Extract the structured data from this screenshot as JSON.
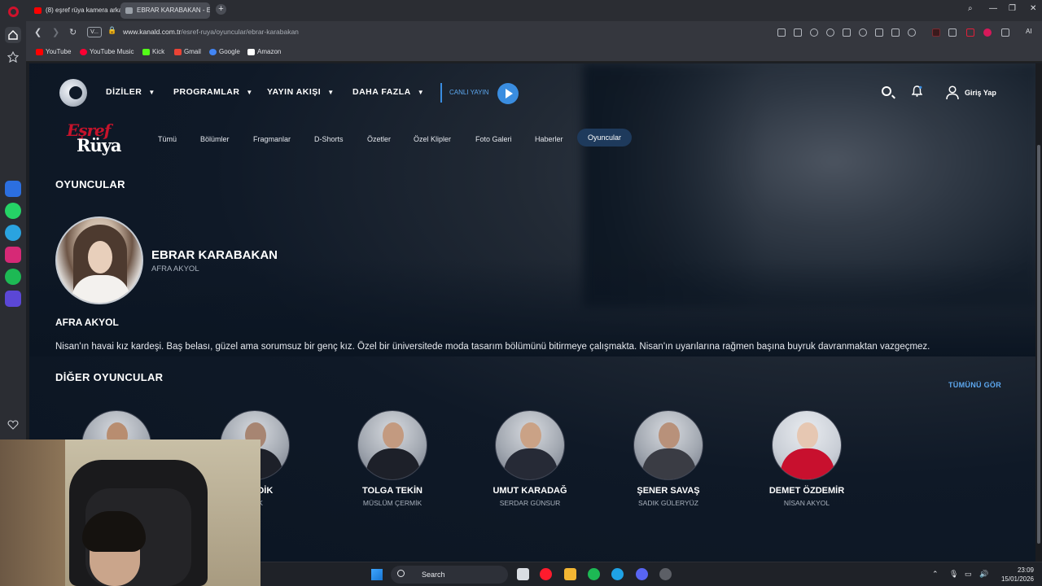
{
  "browser": {
    "tabs": [
      {
        "label": "(8) eşref rüya kamera arka",
        "favicon_color": "#ff0000",
        "active": false
      },
      {
        "label": "EBRAR KARABAKAN - Eşre",
        "favicon_color": "#9aa0a8",
        "active": true
      }
    ],
    "url_badge": "V...",
    "url_domain": "www.kanald.com.tr",
    "url_path": "/esref-ruya/oyuncular/ebrar-karabakan",
    "ai_label": "AI",
    "bookmarks": [
      {
        "label": "YouTube",
        "color": "#ff0000"
      },
      {
        "label": "YouTube Music",
        "color": "#ff0033"
      },
      {
        "label": "Kick",
        "color": "#53fc18"
      },
      {
        "label": "Gmail",
        "color": "#ea4335"
      },
      {
        "label": "Google",
        "color": "#4285f4"
      },
      {
        "label": "Amazon",
        "color": "#ffffff"
      }
    ]
  },
  "site": {
    "nav": [
      {
        "label": "DİZİLER"
      },
      {
        "label": "PROGRAMLAR"
      },
      {
        "label": "YAYIN AKIŞI"
      },
      {
        "label": "DAHA FAZLA"
      }
    ],
    "live_label": "CANLI YAYIN",
    "login_label": "Giriş Yap",
    "show_logo_line1": "Eşref",
    "show_logo_line2": "Rüya",
    "subnav": [
      "Tümü",
      "Bölümler",
      "Fragmanlar",
      "D-Shorts",
      "Özetler",
      "Özel Klipler",
      "Foto Galeri",
      "Haberler",
      "Oyuncular"
    ],
    "subnav_active": "Oyuncular"
  },
  "profile": {
    "section_title": "OYUNCULAR",
    "actor_name": "EBRAR KARABAKAN",
    "actor_role": "AFRA AKYOL",
    "character_name": "AFRA AKYOL",
    "description": "Nisan'ın havai kız kardeşi. Baş belası, güzel ama sorumsuz bir genç kız. Özel bir üniversitede moda tasarım bölümünü bitirmeye çalışmakta. Nisan'ın uyarılarına rağmen başına buyruk davranmaktan vazgeçmez."
  },
  "others": {
    "section_title": "DİĞER OYUNCULAR",
    "see_all": "TÜMÜNÜ GÖR",
    "cast": [
      {
        "name": "",
        "role": ""
      },
      {
        "name": "EVİNDİK",
        "role": "ANIK"
      },
      {
        "name": "TOLGA TEKİN",
        "role": "MÜSLÜM ÇERMİK"
      },
      {
        "name": "UMUT KARADAĞ",
        "role": "SERDAR GÜNSUR"
      },
      {
        "name": "ŞENER SAVAŞ",
        "role": "SADIK GÜLERYÜZ"
      },
      {
        "name": "DEMET ÖZDEMİR",
        "role": "NİSAN AKYOL"
      }
    ]
  },
  "taskbar": {
    "search_label": "Search",
    "time": "23:09",
    "date": "15/01/2026"
  },
  "colors": {
    "accent_blue": "#3a8de0",
    "brand_red": "#c6132b",
    "page_bg": "#0b1522"
  }
}
